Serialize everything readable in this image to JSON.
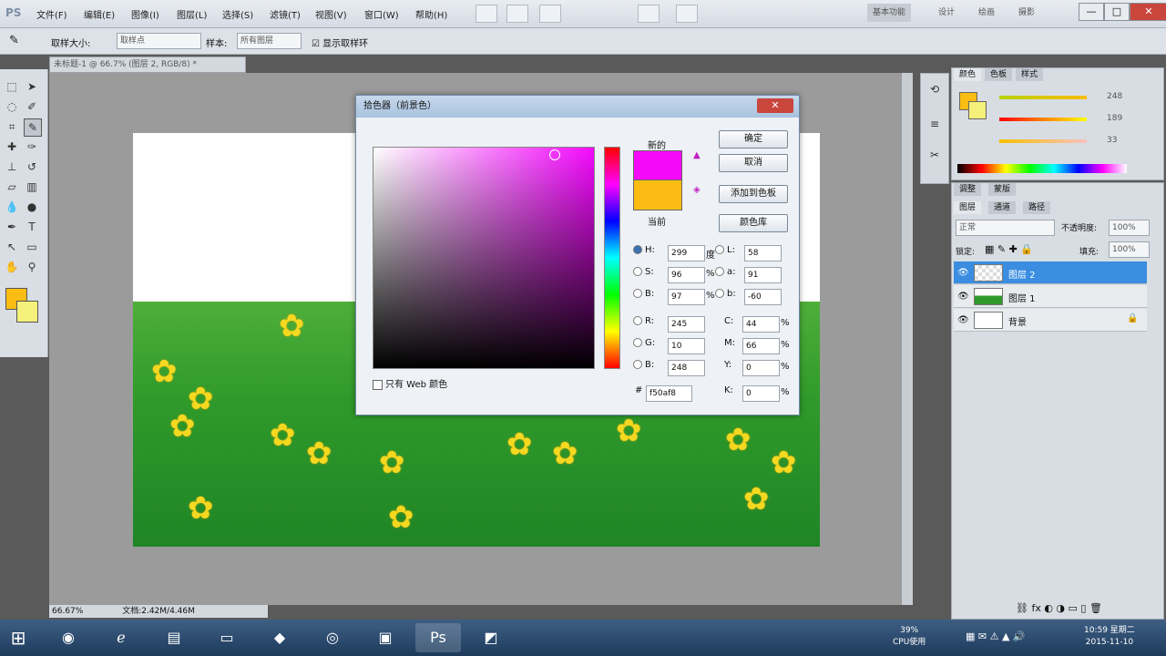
{
  "app": {
    "logo": "PS"
  },
  "menu": [
    "文件(F)",
    "编辑(E)",
    "图像(I)",
    "图层(L)",
    "选择(S)",
    "滤镜(T)",
    "视图(V)",
    "窗口(W)",
    "帮助(H)"
  ],
  "workspace": [
    "基本功能",
    "设计",
    "绘画",
    "摄影"
  ],
  "window_controls": {
    "minimize": "—",
    "restore": "□",
    "close": "✕"
  },
  "options": {
    "sample_size_label": "取样大小:",
    "sample_size_value": "取样点",
    "sample_label": "样本:",
    "sample_value": "所有图层",
    "show_ring_label": "☑ 显示取样环"
  },
  "doc_tab": "未标题-1 @ 66.7% (图层 2, RGB/8) *",
  "status": {
    "zoom": "66.67%",
    "doc": "文档:2.42M/4.46M"
  },
  "dialog": {
    "title": "拾色器（前景色）",
    "close": "✕",
    "new_label": "新的",
    "current_label": "当前",
    "buttons": {
      "ok": "确定",
      "cancel": "取消",
      "swatches": "添加到色板",
      "libraries": "颜色库"
    },
    "web_only": "只有 Web 颜色",
    "fields": {
      "H": {
        "label": "H:",
        "value": "299",
        "unit": "度"
      },
      "S": {
        "label": "S:",
        "value": "96",
        "unit": "%"
      },
      "B": {
        "label": "B:",
        "value": "97",
        "unit": "%"
      },
      "R": {
        "label": "R:",
        "value": "245"
      },
      "G": {
        "label": "G:",
        "value": "10"
      },
      "Bl": {
        "label": "B:",
        "value": "248"
      },
      "L": {
        "label": "L:",
        "value": "58"
      },
      "a": {
        "label": "a:",
        "value": "91"
      },
      "b": {
        "label": "b:",
        "value": "-60"
      },
      "C": {
        "label": "C:",
        "value": "44",
        "unit": "%"
      },
      "M": {
        "label": "M:",
        "value": "66",
        "unit": "%"
      },
      "Y": {
        "label": "Y:",
        "value": "0",
        "unit": "%"
      },
      "K": {
        "label": "K:",
        "value": "0",
        "unit": "%"
      },
      "hex": {
        "label": "#",
        "value": "f50af8"
      }
    },
    "new_color": "#f50af8",
    "current_color": "#fbbd13"
  },
  "color_panel": {
    "tabs": [
      "颜色",
      "色板",
      "样式"
    ],
    "values": [
      "248",
      "189",
      "33"
    ]
  },
  "layers_panel": {
    "tabs": [
      "调整",
      "蒙版"
    ],
    "sub_tabs": [
      "图层",
      "通道",
      "路径"
    ],
    "blend": "正常",
    "opacity_label": "不透明度:",
    "opacity": "100%",
    "lock_label": "锁定:",
    "fill_label": "填充:",
    "fill": "100%",
    "layers": [
      {
        "name": "图层 2"
      },
      {
        "name": "图层 1"
      },
      {
        "name": "背景"
      }
    ]
  },
  "taskbar": {
    "cpu": "39%",
    "cpu_label": "CPU使用",
    "time": "10:59 星期二",
    "date": "2015-11-10"
  }
}
